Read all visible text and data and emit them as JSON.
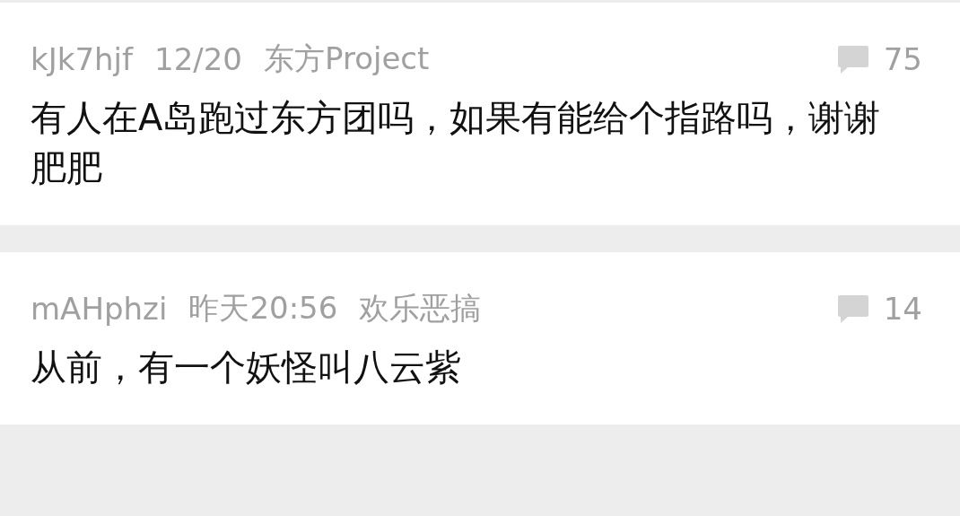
{
  "posts": [
    {
      "author": "kJk7hjf",
      "time": "12/20",
      "board": "东方Project",
      "comments": "75",
      "text": "有人在A岛跑过东方团吗，如果有能给个指路吗，谢谢肥肥"
    },
    {
      "author": "mAHphzi",
      "time": "昨天20:56",
      "board": "欢乐恶搞",
      "comments": "14",
      "text": "从前，有一个妖怪叫八云紫"
    }
  ]
}
